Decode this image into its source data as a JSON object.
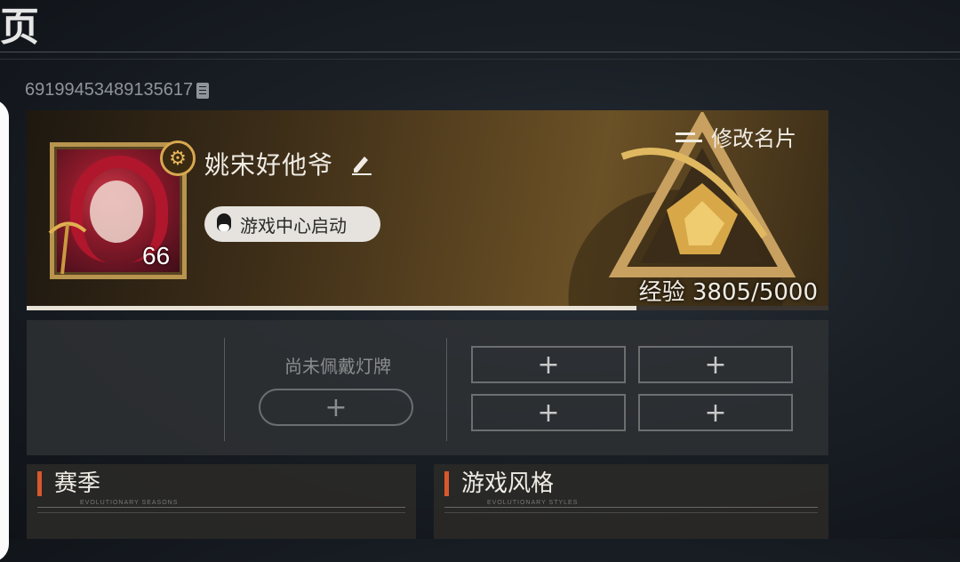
{
  "page": {
    "title_fragment": "页"
  },
  "player": {
    "id": "691994534891356 17",
    "name": "姚宋好他爷",
    "level": "66",
    "launch_badge": "游戏中心启动",
    "modify_card_label": "修改名片",
    "exp_text": "经验 3805/5000",
    "exp_current": 3805,
    "exp_max": 5000
  },
  "nameplate": {
    "empty_label": "尚未佩戴灯牌",
    "add_symbol": "+"
  },
  "slots": [
    "+",
    "+",
    "+",
    "+"
  ],
  "sections": [
    {
      "title": "赛季",
      "subtitle": "EVOLUTIONARY SEASONS"
    },
    {
      "title": "游戏风格",
      "subtitle": "EVOLUTIONARY STYLES"
    }
  ],
  "colors": {
    "accent": "#d8582c",
    "frame_gold": "#b8944e"
  }
}
